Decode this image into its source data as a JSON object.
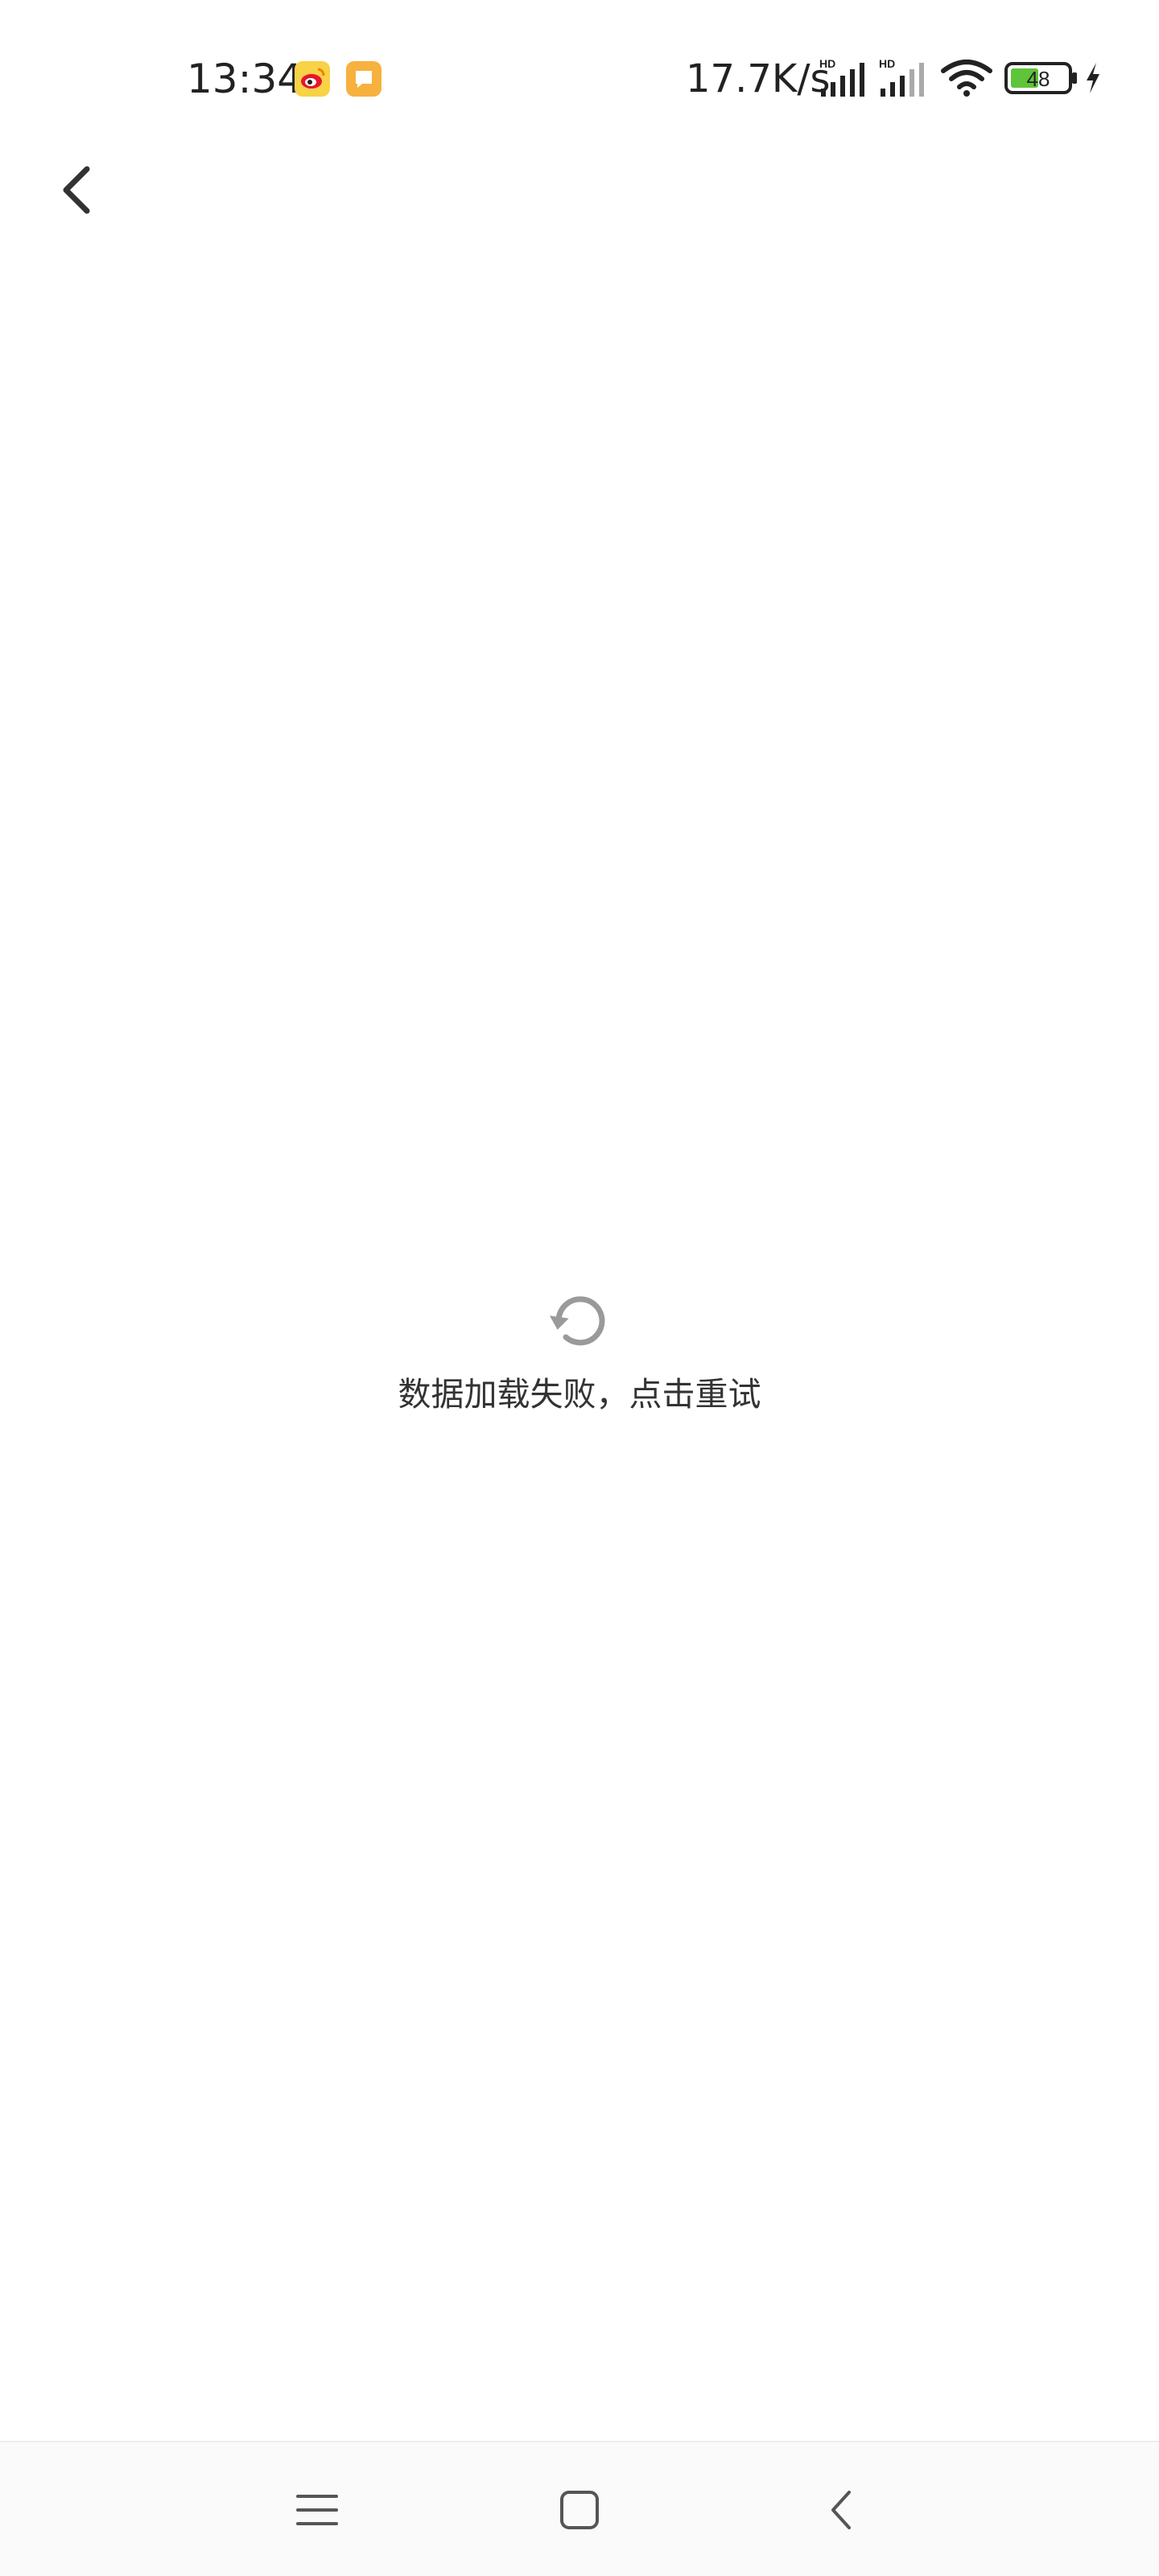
{
  "status_bar": {
    "time": "13:34",
    "network_speed": "17.7K/s",
    "signal_1_label": "HD",
    "signal_2_label": "HD",
    "battery_level": "48",
    "notification_icons": [
      "weibo-icon",
      "message-icon"
    ]
  },
  "toolbar": {
    "back_icon": "chevron-left-icon"
  },
  "error_state": {
    "icon": "refresh-icon",
    "message": "数据加载失败，点击重试"
  },
  "nav_bar": {
    "menu_icon": "menu-icon",
    "home_icon": "home-icon",
    "back_icon": "back-icon"
  },
  "colors": {
    "battery_fill": "#5ec43a",
    "weibo_bg": "#f8d247",
    "message_bg": "#f7b13e",
    "icon_gray": "#9a9a9a"
  }
}
